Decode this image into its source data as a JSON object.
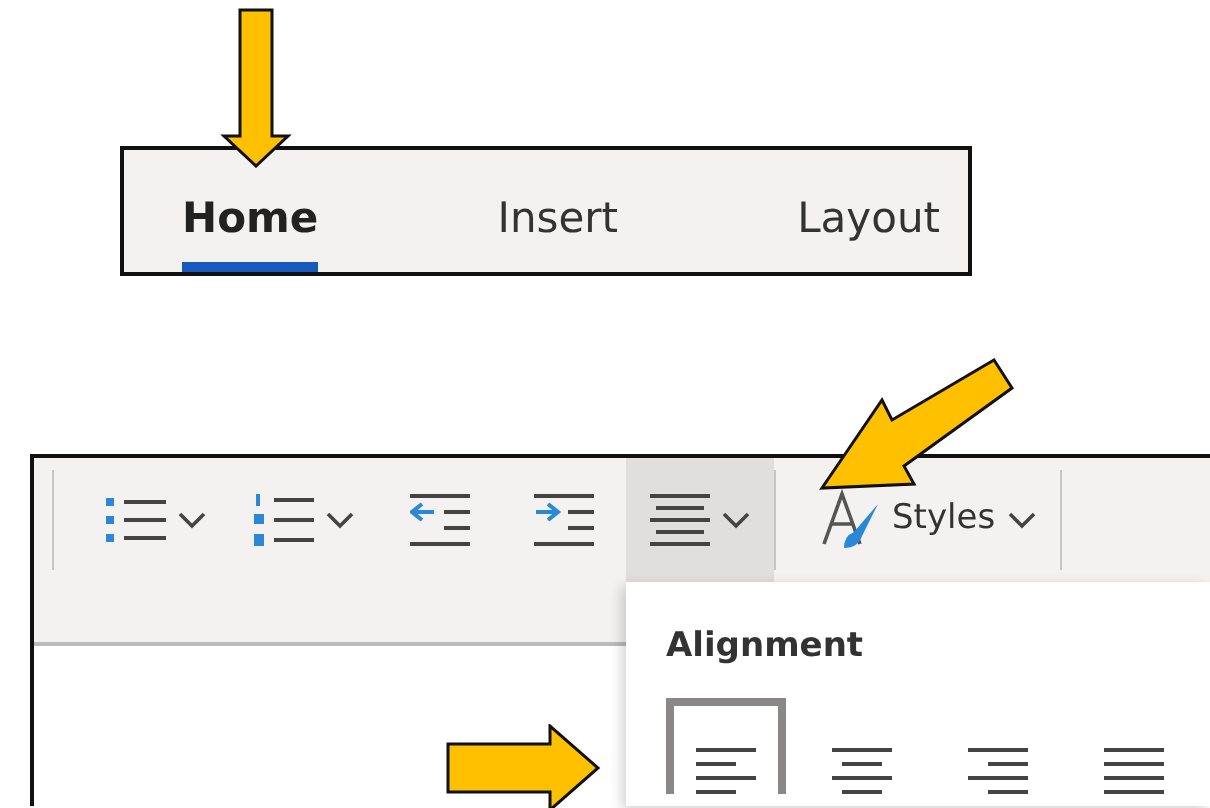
{
  "ribbon_tabs": [
    {
      "label": "Home",
      "selected": true
    },
    {
      "label": "Insert",
      "selected": false
    },
    {
      "label": "Layout",
      "selected": false
    }
  ],
  "toolbar": {
    "buttons": [
      {
        "kind": "bullets",
        "selected": false
      },
      {
        "kind": "numbering",
        "selected": false
      },
      {
        "kind": "outdent",
        "selected": false
      },
      {
        "kind": "indent",
        "selected": false
      },
      {
        "kind": "align",
        "selected": true
      },
      {
        "kind": "styles",
        "label": "Styles",
        "selected": false
      }
    ]
  },
  "alignment_menu": {
    "title": "Alignment",
    "options": [
      {
        "kind": "left",
        "selected": true
      },
      {
        "kind": "center",
        "selected": false
      },
      {
        "kind": "right",
        "selected": false
      },
      {
        "kind": "justify",
        "selected": false
      }
    ]
  },
  "arrows": [
    {
      "kind": "down"
    },
    {
      "kind": "diagonal"
    },
    {
      "kind": "side"
    }
  ]
}
